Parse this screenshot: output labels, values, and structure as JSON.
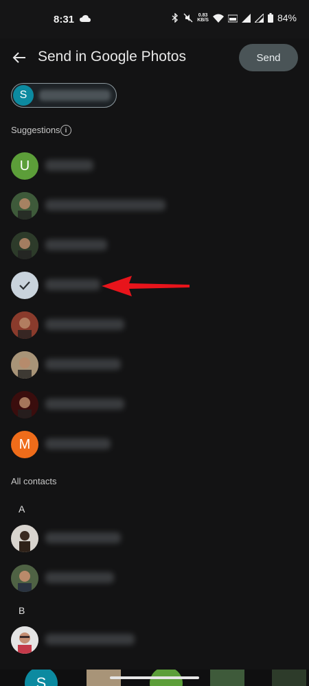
{
  "status": {
    "time": "8:31",
    "net_speed_value": "0.83",
    "net_speed_unit": "KB/S",
    "battery": "84%"
  },
  "toolbar": {
    "title": "Send in Google Photos",
    "send_label": "Send"
  },
  "selected_chip": {
    "initial": "S"
  },
  "suggestions": {
    "label": "Suggestions",
    "items": [
      {
        "initial": "U",
        "avatar_color": "#5c9e39",
        "type": "initial"
      },
      {
        "type": "photo",
        "avatar_color": "#3e5a3a"
      },
      {
        "type": "photo",
        "avatar_color": "#2d3b2a"
      },
      {
        "type": "check",
        "avatar_color": "#c9d3dc",
        "selected": true
      },
      {
        "type": "photo",
        "avatar_color": "#8a3b2c"
      },
      {
        "type": "photo",
        "avatar_color": "#a89478"
      },
      {
        "type": "photo",
        "avatar_color": "#3a0d0d"
      },
      {
        "initial": "M",
        "avatar_color": "#ef6c1a",
        "type": "initial"
      }
    ]
  },
  "all_contacts": {
    "label": "All contacts",
    "groups": [
      {
        "letter": "A"
      },
      {
        "letter": "B"
      }
    ]
  },
  "colors": {
    "background": "#131314",
    "send_button": "#4a5457",
    "annotation_arrow": "#e8141b"
  }
}
